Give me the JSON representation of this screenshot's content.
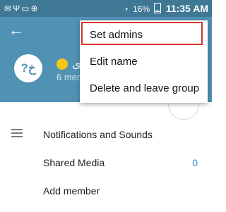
{
  "status_bar": {
    "left_icons": [
      "notification-icon",
      "usb-icon",
      "line-icon",
      "add-icon"
    ],
    "right_icons": [
      "notification-icon",
      "mail-icon",
      "wifi-icon"
    ],
    "battery": "16%",
    "time": "11:35 AM"
  },
  "toolbar": {
    "avatar_text": "?خ",
    "group_name": "ی",
    "subtitle": "6 mem"
  },
  "menu": {
    "items": [
      {
        "label": "Set admins"
      },
      {
        "label": "Edit name"
      },
      {
        "label": "Delete and leave group"
      }
    ]
  },
  "settings": {
    "notifications": "Notifications and Sounds",
    "shared_media": "Shared Media",
    "shared_media_count": "0",
    "add_member": "Add member"
  },
  "colors": {
    "header": "#5192b4",
    "status_bar": "#3e7894",
    "highlight": "#d9342b",
    "accent": "#3b8ed0"
  }
}
